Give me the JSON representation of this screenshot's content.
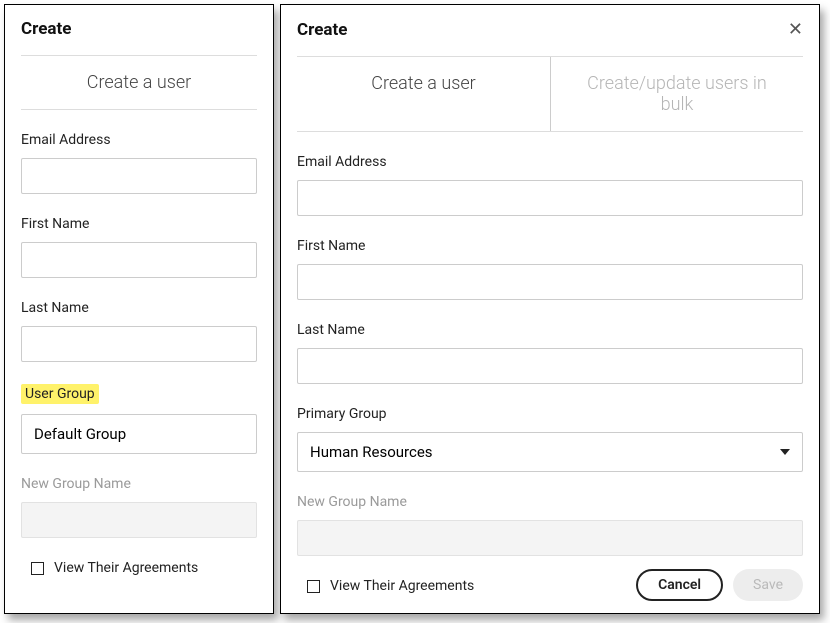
{
  "left": {
    "title": "Create",
    "tab_create_user": "Create a user",
    "email_label": "Email Address",
    "first_name_label": "First Name",
    "last_name_label": "Last Name",
    "user_group_label": "User Group",
    "user_group_value": "Default Group",
    "new_group_label": "New Group Name",
    "view_agreements_label": "View Their Agreements"
  },
  "right": {
    "title": "Create",
    "tab_create_user": "Create a user",
    "tab_bulk": "Create/update users in bulk",
    "email_label": "Email Address",
    "first_name_label": "First Name",
    "last_name_label": "Last Name",
    "primary_group_label": "Primary Group",
    "primary_group_value": "Human Resources",
    "new_group_label": "New Group Name",
    "view_agreements_label": "View Their Agreements",
    "cancel_label": "Cancel",
    "save_label": "Save"
  }
}
